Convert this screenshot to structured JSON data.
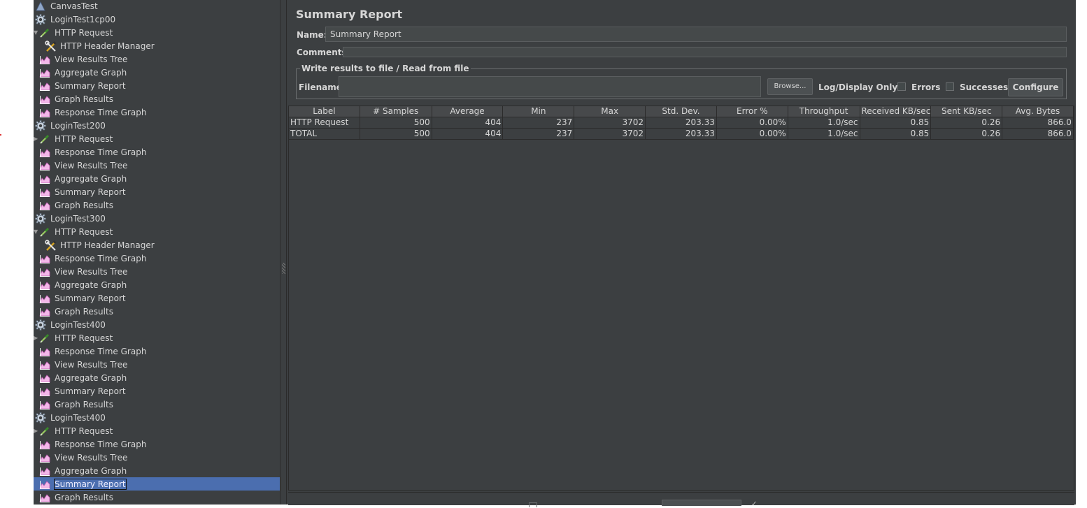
{
  "tree": {
    "items": [
      {
        "label": "CanvasTest",
        "icon": "test-plan-icon",
        "level": 0,
        "expander": ""
      },
      {
        "label": "LoginTest1cp00",
        "icon": "gear-icon",
        "level": 0,
        "expander": ""
      },
      {
        "label": "HTTP Request",
        "icon": "pipette-icon",
        "level": 1,
        "expander": "▼"
      },
      {
        "label": "HTTP Header Manager",
        "icon": "wrench-screwdriver-icon",
        "level": 2,
        "expander": ""
      },
      {
        "label": "View Results Tree",
        "icon": "graph-icon",
        "level": 1,
        "expander": ""
      },
      {
        "label": "Aggregate Graph",
        "icon": "graph-icon",
        "level": 1,
        "expander": ""
      },
      {
        "label": "Summary Report",
        "icon": "graph-icon",
        "level": 1,
        "expander": ""
      },
      {
        "label": "Graph Results",
        "icon": "graph-icon",
        "level": 1,
        "expander": ""
      },
      {
        "label": "Response Time Graph",
        "icon": "graph-icon",
        "level": 1,
        "expander": ""
      },
      {
        "label": "LoginTest200",
        "icon": "gear-icon",
        "level": 0,
        "expander": ""
      },
      {
        "label": "HTTP Request",
        "icon": "pipette-icon",
        "level": 1,
        "expander": "▶"
      },
      {
        "label": "Response Time Graph",
        "icon": "graph-icon",
        "level": 1,
        "expander": ""
      },
      {
        "label": "View Results Tree",
        "icon": "graph-icon",
        "level": 1,
        "expander": ""
      },
      {
        "label": "Aggregate Graph",
        "icon": "graph-icon",
        "level": 1,
        "expander": ""
      },
      {
        "label": "Summary Report",
        "icon": "graph-icon",
        "level": 1,
        "expander": ""
      },
      {
        "label": "Graph Results",
        "icon": "graph-icon",
        "level": 1,
        "expander": ""
      },
      {
        "label": "LoginTest300",
        "icon": "gear-icon",
        "level": 0,
        "expander": ""
      },
      {
        "label": "HTTP Request",
        "icon": "pipette-icon",
        "level": 1,
        "expander": "▼"
      },
      {
        "label": "HTTP Header Manager",
        "icon": "wrench-screwdriver-icon",
        "level": 2,
        "expander": ""
      },
      {
        "label": "Response Time Graph",
        "icon": "graph-icon",
        "level": 1,
        "expander": ""
      },
      {
        "label": "View Results Tree",
        "icon": "graph-icon",
        "level": 1,
        "expander": ""
      },
      {
        "label": "Aggregate Graph",
        "icon": "graph-icon",
        "level": 1,
        "expander": ""
      },
      {
        "label": "Summary Report",
        "icon": "graph-icon",
        "level": 1,
        "expander": ""
      },
      {
        "label": "Graph Results",
        "icon": "graph-icon",
        "level": 1,
        "expander": ""
      },
      {
        "label": "LoginTest400",
        "icon": "gear-icon",
        "level": 0,
        "expander": ""
      },
      {
        "label": "HTTP Request",
        "icon": "pipette-icon",
        "level": 1,
        "expander": "▶"
      },
      {
        "label": "Response Time Graph",
        "icon": "graph-icon",
        "level": 1,
        "expander": ""
      },
      {
        "label": "View Results Tree",
        "icon": "graph-icon",
        "level": 1,
        "expander": ""
      },
      {
        "label": "Aggregate Graph",
        "icon": "graph-icon",
        "level": 1,
        "expander": ""
      },
      {
        "label": "Summary Report",
        "icon": "graph-icon",
        "level": 1,
        "expander": ""
      },
      {
        "label": "Graph Results",
        "icon": "graph-icon",
        "level": 1,
        "expander": ""
      },
      {
        "label": "LoginTest400",
        "icon": "gear-icon",
        "level": 0,
        "expander": ""
      },
      {
        "label": "HTTP Request",
        "icon": "pipette-icon",
        "level": 1,
        "expander": "▶"
      },
      {
        "label": "Response Time Graph",
        "icon": "graph-icon",
        "level": 1,
        "expander": ""
      },
      {
        "label": "View Results Tree",
        "icon": "graph-icon",
        "level": 1,
        "expander": ""
      },
      {
        "label": "Aggregate Graph",
        "icon": "graph-icon",
        "level": 1,
        "expander": ""
      },
      {
        "label": "Summary Report",
        "icon": "graph-icon",
        "level": 1,
        "expander": "",
        "selected": true
      },
      {
        "label": "Graph Results",
        "icon": "graph-icon",
        "level": 1,
        "expander": ""
      }
    ]
  },
  "panel": {
    "title": "Summary Report",
    "name_label": "Name:",
    "name_value": "Summary Report",
    "comments_label": "Comments:",
    "file_group_legend": "Write results to file / Read from file",
    "filename_label": "Filename",
    "filename_value": "",
    "browse_label": "Browse...",
    "log_display_label": "Log/Display Only:",
    "errors_label": "Errors",
    "errors_checked": false,
    "successes_label": "Successes",
    "successes_checked": false,
    "configure_label": "Configure"
  },
  "table": {
    "columns": [
      "Label",
      "# Samples",
      "Average",
      "Min",
      "Max",
      "Std. Dev.",
      "Error %",
      "Throughput",
      "Received KB/sec",
      "Sent KB/sec",
      "Avg. Bytes"
    ],
    "rows": [
      [
        "HTTP Request",
        "500",
        "404",
        "237",
        "3702",
        "203.33",
        "0.00%",
        "1.0/sec",
        "0.85",
        "0.26",
        "866.0"
      ],
      [
        "TOTAL",
        "500",
        "404",
        "237",
        "3702",
        "203.33",
        "0.00%",
        "1.0/sec",
        "0.85",
        "0.26",
        "866.0"
      ]
    ]
  },
  "colors": {
    "background": "#3c3f41",
    "selection": "#4b6eaf",
    "text": "#d6d6d6"
  }
}
